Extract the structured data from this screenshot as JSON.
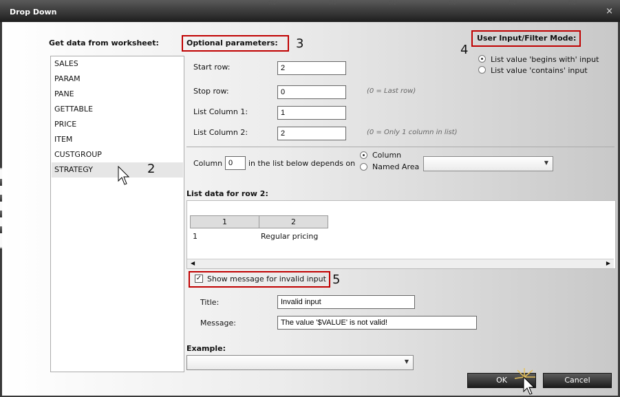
{
  "window": {
    "title": "Drop Down",
    "close_glyph": "×",
    "bg_labels": [
      "RV",
      "RV",
      "RV",
      "RV",
      "RV",
      "RV"
    ]
  },
  "worksheet": {
    "label": "Get data from worksheet:",
    "items": [
      "SALES",
      "PARAM",
      "PANE",
      "GETTABLE",
      "PRICE",
      "ITEM",
      "CUSTGROUP",
      "STRATEGY"
    ],
    "selected": "STRATEGY"
  },
  "annotations": {
    "n2": "2",
    "n3": "3",
    "n4": "4",
    "n5": "5"
  },
  "optional": {
    "label": "Optional parameters:",
    "start_row": {
      "label": "Start row:",
      "value": "2"
    },
    "stop_row": {
      "label": "Stop row:",
      "value": "0",
      "hint": "(0 = Last row)"
    },
    "list_col1": {
      "label": "List Column 1:",
      "value": "1"
    },
    "list_col2": {
      "label": "List Column 2:",
      "value": "2",
      "hint": "(0 = Only 1 column in list)"
    }
  },
  "filter_mode": {
    "label": "User Input/Filter Mode:",
    "options": [
      "List value 'begins with' input",
      "List value 'contains' input"
    ],
    "selected": 0
  },
  "depends": {
    "prefix": "Column",
    "value": "0",
    "suffix": "in the list below depends on",
    "options": [
      "Column",
      "Named Area"
    ],
    "selected": 0,
    "named_area_value": ""
  },
  "list_data": {
    "label": "List data for row 2:",
    "headers": [
      "1",
      "2"
    ],
    "rows": [
      [
        "1",
        "Regular pricing"
      ]
    ]
  },
  "invalid": {
    "checkbox_label": "Show message for invalid input",
    "checked": true,
    "title_label": "Title:",
    "title_value": "Invalid input",
    "message_label": "Message:",
    "message_value": "The value '$VALUE' is not valid!"
  },
  "example": {
    "label": "Example:",
    "value": ""
  },
  "buttons": {
    "ok": "OK",
    "cancel": "Cancel"
  }
}
